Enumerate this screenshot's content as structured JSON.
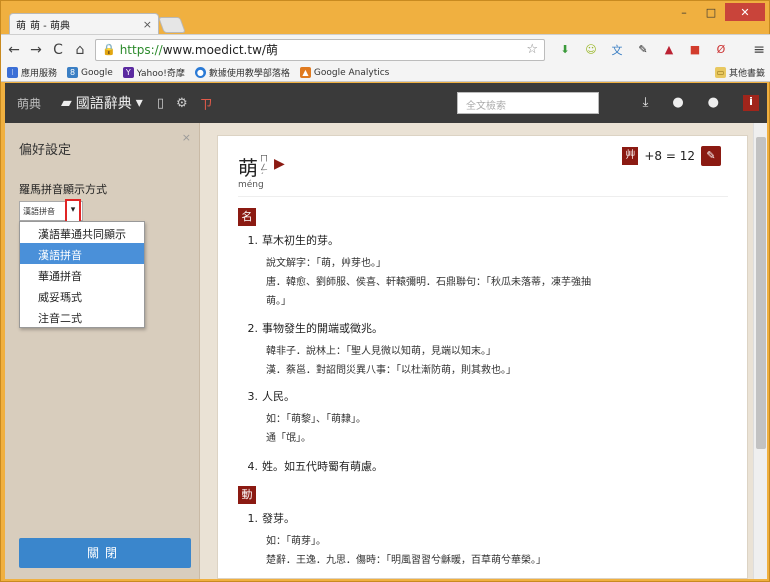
{
  "browser": {
    "tab_title": "萌 - 萌典",
    "tab_favicon": "萌",
    "url_https": "https://",
    "url_rest": "www.moedict.tw/萌",
    "bookmarks": [
      "應用服務",
      "Google",
      "Yahoo!奇摩",
      "數據使用教學部落格",
      "Google Analytics"
    ],
    "bookmark_other": "其他書籤"
  },
  "site": {
    "logo": "萌典",
    "dict_label": "國語辭典",
    "search_placeholder": "全文檢索"
  },
  "pref": {
    "title": "偏好設定",
    "label": "羅馬拼音顯示方式",
    "selected": "漢語拼音",
    "options": [
      "漢語華通共同顯示",
      "漢語拼音",
      "華通拼音",
      "威妥瑪式",
      "注音二式"
    ],
    "close_label": "關閉"
  },
  "entry": {
    "char": "萌",
    "bopomofo": "ㄇㄥˊ",
    "pinyin": "méng",
    "radical": "艸",
    "strokes": "+8 = 12",
    "pos1": "名",
    "pos2": "動",
    "defs": [
      {
        "num": "1.",
        "text": "草木初生的芽。"
      },
      {
        "num": "2.",
        "text": "事物發生的開端或徵兆。"
      },
      {
        "num": "3.",
        "text": "人民。"
      },
      {
        "num": "4.",
        "text": "姓。如五代時蜀有萌慮。"
      },
      {
        "num": "1.",
        "text": "發芽。"
      }
    ],
    "examples": [
      "說文解字：「萌，艸芽也。」",
      "唐．韓愈、劉師服、侯喜、軒轅彌明．石鼎聯句：「秋瓜未落蒂，凍芋強抽",
      "萌。」",
      "韓非子．說林上：「聖人見微以知萌，見端以知末。」",
      "漢．蔡邕．對詔問災異八事：「以杜漸防萌，則其救也。」",
      "如：「萌黎」、「萌隸」。",
      "通「氓」。",
      "如：「萌芽」。",
      "楚辭．王逸．九思．傷時：「明風習習兮龢暖，百草萌兮華榮。」"
    ]
  }
}
